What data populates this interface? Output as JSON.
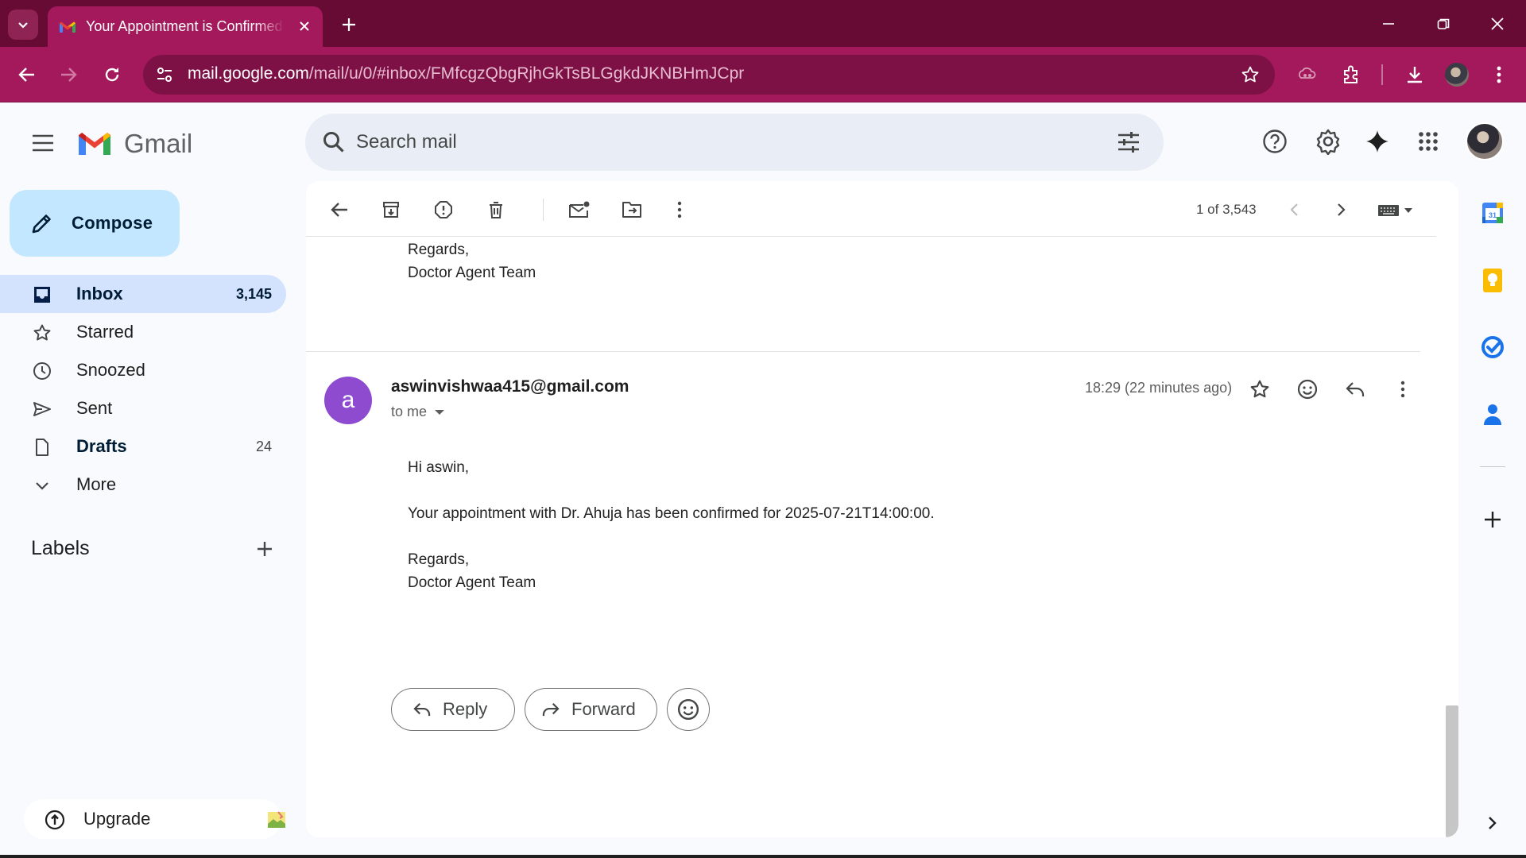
{
  "browser": {
    "tab_title": "Your Appointment is Confirmed",
    "url_host": "mail.google.com",
    "url_path": "/mail/u/0/#inbox/FMfcgzQbgRjhGkTsBLGgkdJKNBHmJCpr"
  },
  "gmail": {
    "logo_text": "Gmail",
    "search_placeholder": "Search mail",
    "compose_label": "Compose"
  },
  "nav": {
    "items": [
      {
        "label": "Inbox",
        "count": "3,145"
      },
      {
        "label": "Starred",
        "count": ""
      },
      {
        "label": "Snoozed",
        "count": ""
      },
      {
        "label": "Sent",
        "count": ""
      },
      {
        "label": "Drafts",
        "count": "24"
      },
      {
        "label": "More",
        "count": ""
      }
    ],
    "labels_heading": "Labels",
    "upgrade_label": "Upgrade"
  },
  "toolbar": {
    "pager": "1 of 3,543"
  },
  "previous_message": {
    "signature_line1": "Regards,",
    "signature_line2": "Doctor Agent Team"
  },
  "message": {
    "avatar_letter": "a",
    "sender": "aswinvishwaa415@gmail.com",
    "recipient": "to me",
    "time": "18:29 (22 minutes ago)",
    "greeting": "Hi aswin,",
    "body": "Your appointment with Dr. Ahuja has been confirmed for 2025-07-21T14:00:00.",
    "closing": "Regards,",
    "signature": "Doctor Agent Team"
  },
  "actions": {
    "reply_label": "Reply",
    "forward_label": "Forward"
  },
  "colors": {
    "browser_frame": "#670b35",
    "browser_toolbar": "#a3195b",
    "compose_bg": "#c2e7ff",
    "inbox_active_bg": "#d3e3fd",
    "sender_avatar": "#8e4bd0"
  },
  "side_panel": {
    "calendar_day": "31"
  }
}
